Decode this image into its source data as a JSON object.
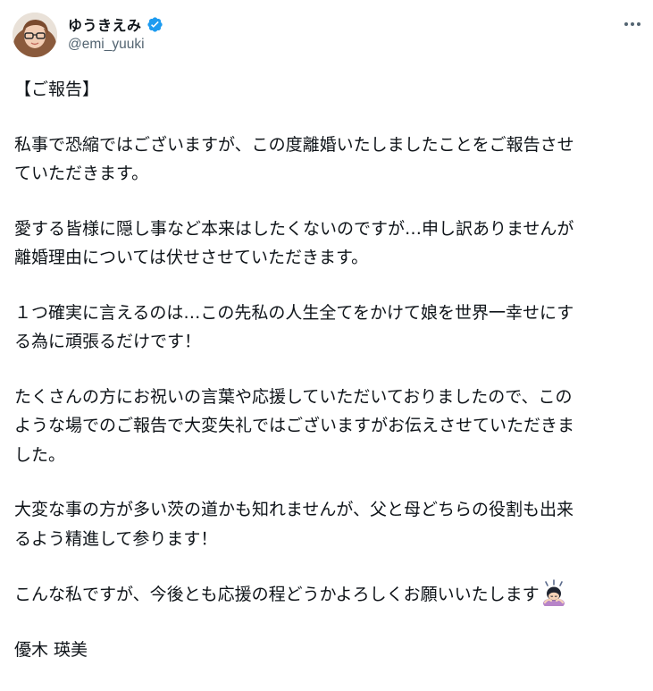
{
  "post": {
    "author": {
      "display_name": "ゆうきえみ",
      "handle": "@emi_yuuki",
      "verified": true,
      "verified_color": "#1d9bf0"
    },
    "menu_icon": "more-horizontal-icon",
    "paragraphs": [
      [
        "【ご報告】"
      ],
      [
        "私事で恐縮ではございますが、この度離婚いたしましたことをご報告させ",
        "ていただきます。"
      ],
      [
        "愛する皆様に隠し事など本来はしたくないのですが…申し訳ありませんが",
        "離婚理由については伏せさせていただきます。"
      ],
      [
        "１つ確実に言えるのは…この先私の人生全てをかけて娘を世界一幸せにす",
        "る為に頑張るだけです！"
      ],
      [
        "たくさんの方にお祝いの言葉や応援していただいておりましたので、この",
        "ような場でのご報告で大変失礼ではございますがお伝えさせていただきま",
        "した。"
      ],
      [
        "大変な事の方が多い茨の道かも知れませんが、父と母どちらの役割も出来",
        "るよう精進して参ります！"
      ],
      [
        "こんな私ですが、今後とも応援の程どうかよろしくお願いいたします"
      ],
      [
        "優木 瑛美"
      ]
    ],
    "emoji_icon": "bowing-woman-emoji",
    "text_color": "#0f1419",
    "secondary_color": "#536471"
  }
}
